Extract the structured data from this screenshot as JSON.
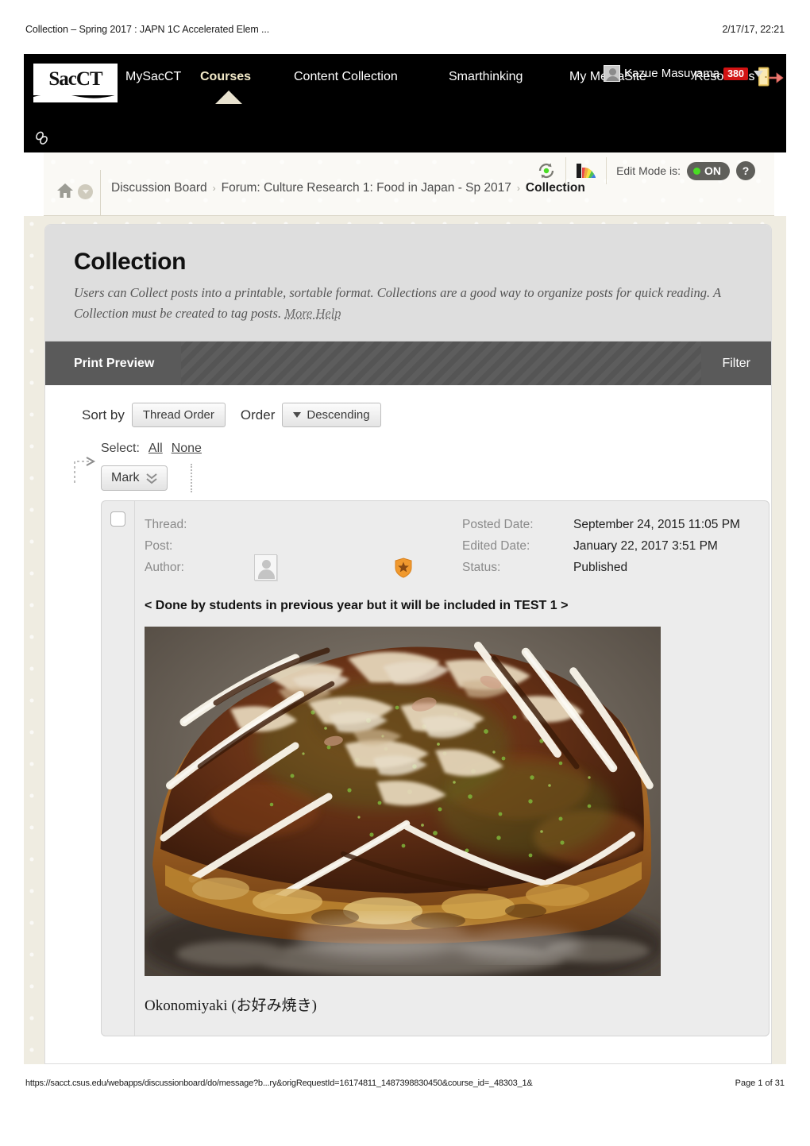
{
  "print": {
    "header_title": "Collection – Spring 2017 : JAPN 1C Accelerated Elem ...",
    "header_timestamp": "2/17/17, 22:21",
    "footer_url": "https://sacct.csus.edu/webapps/discussionboard/do/message?b...ry&origRequestId=16174811_1487398830450&course_id=_48303_1&",
    "footer_page": "Page 1 of 31"
  },
  "topnav": {
    "logo_text": "SacCT",
    "items": [
      {
        "label": "MySacCT",
        "active": false
      },
      {
        "label": "Courses",
        "active": true
      },
      {
        "label": "Content Collection",
        "active": false
      },
      {
        "label": "Smarthinking",
        "active": false
      },
      {
        "label": "My MediaSite",
        "active": false
      },
      {
        "label": "Resources",
        "active": false
      }
    ],
    "user_name": "Kazue Masuyama",
    "notification_count": "380",
    "avatar_icon": "user-avatar-icon",
    "dropdown_icon": "caret-down-icon",
    "logout_icon": "logout-door-icon",
    "chain_icon": "chain-link-icon"
  },
  "breadcrumb": {
    "home_icon": "home-icon",
    "home_dropdown_icon": "chevron-down-icon",
    "items": [
      "Discussion Board",
      "Forum: Culture Research 1: Food in Japan - Sp 2017"
    ],
    "current": "Collection",
    "separator": "›",
    "refresh_icon": "refresh-icon",
    "palette_icon": "color-palette-icon",
    "edit_mode_label": "Edit Mode is:",
    "edit_mode_state": "ON",
    "help_label": "?"
  },
  "page": {
    "title": "Collection",
    "description_part1": "Users can Collect posts into a printable, sortable format. Collections are a good way to organize posts for quick reading. A Collection must be created to tag posts. ",
    "more_help_label": "More Help"
  },
  "action_bar": {
    "print_preview_label": "Print Preview",
    "filter_label": "Filter"
  },
  "controls": {
    "sort_by_label": "Sort by",
    "sort_by_value": "Thread Order",
    "order_label": "Order",
    "order_value": "Descending",
    "order_caret_icon": "caret-down-icon",
    "select_label": "Select:",
    "select_all_label": "All",
    "select_none_label": "None",
    "mark_label": "Mark",
    "mark_chevron_icon": "double-chevron-down-icon",
    "pointer_arrow_icon": "dashed-arrow-right-icon"
  },
  "post": {
    "checkbox_state": "unchecked",
    "labels": {
      "thread": "Thread:",
      "post": "Post:",
      "author": "Author:",
      "posted_date": "Posted Date:",
      "edited_date": "Edited Date:",
      "status": "Status:"
    },
    "values": {
      "thread": "",
      "post": "",
      "author": "",
      "posted_date": "September 24, 2015 11:05 PM",
      "edited_date": "January 22, 2017 3:51 PM",
      "status": "Published"
    },
    "author_avatar_icon": "user-avatar-icon",
    "author_badge_icon": "shield-star-badge-icon",
    "headline": "< Done by students in previous year but it will be included in TEST 1 >",
    "image_alt": "okonomiyaki-photo",
    "caption": "Okonomiyaki (お好み焼き)"
  },
  "colors": {
    "nav_bg": "#000000",
    "nav_active": "#f2e9c8",
    "badge_red": "#d21313",
    "page_bg": "#efece1",
    "card_head": "#dedede",
    "bar_dark": "#5a5a5a",
    "toggle_green": "#49dc24",
    "panel_bg": "#ececec"
  }
}
